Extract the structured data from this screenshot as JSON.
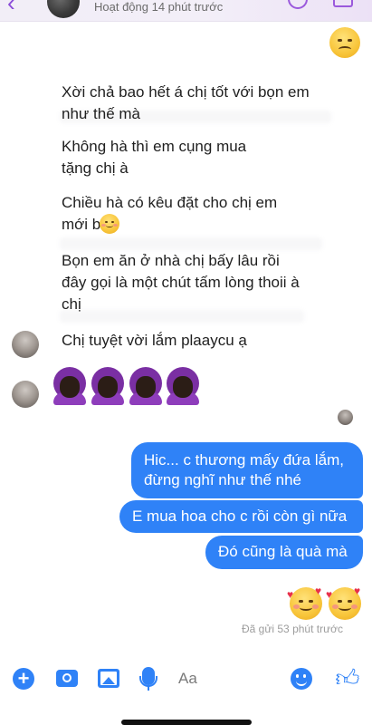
{
  "header": {
    "status": "Hoạt động 14 phút trước",
    "back_icon": "chevron-left-icon",
    "call_icon": "phone-icon",
    "video_icon": "video-icon"
  },
  "messages_received": [
    {
      "text": "Xời chả bao hết á chị tốt với bọn em như thế mà"
    },
    {
      "text": "Không hà thì em cụng mua tặng chị à"
    },
    {
      "text": "Chiều hà có kêu đặt cho chị em mới bt ý"
    },
    {
      "text": "Bọn em ăn ở nhà chị bấy lâu rồi đây gọi là một chút tấm lòng thoii à chị"
    },
    {
      "text": "Chị tuyệt vời lắm plaaycu ạ"
    }
  ],
  "messages_sent": [
    {
      "text": "Hic... c thương mấy đứa lắm, đừng nghĩ như thế nhé"
    },
    {
      "text": "E mua hoa cho c rồi còn gì nữa"
    },
    {
      "text": "Đó cũng là quà mà"
    }
  ],
  "sent_status": "Đã gửi 53 phút trước",
  "composer": {
    "placeholder": "Aa",
    "value": ""
  },
  "colors": {
    "accent": "#2f82f7",
    "header_accent": "#9b59dc",
    "emoji_purple": "#7a2fa3"
  }
}
